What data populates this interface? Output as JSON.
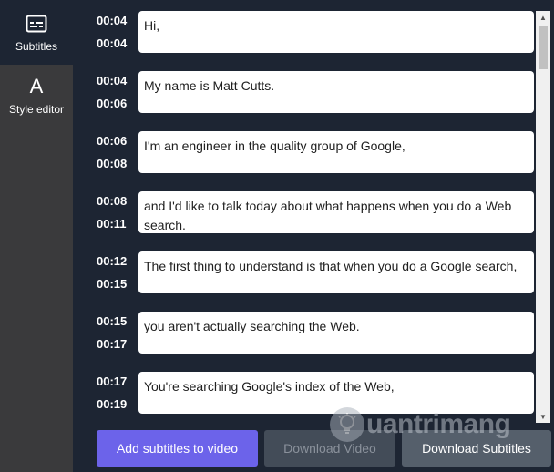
{
  "sidebar": {
    "items": [
      {
        "label": "Subtitles",
        "icon": "subtitles-icon"
      },
      {
        "label": "Style editor",
        "icon": "letter-a-icon",
        "glyph": "A"
      }
    ]
  },
  "subtitles": [
    {
      "start": "00:04",
      "end": "00:04",
      "text": "Hi,"
    },
    {
      "start": "00:04",
      "end": "00:06",
      "text": "My name is Matt Cutts."
    },
    {
      "start": "00:06",
      "end": "00:08",
      "text": "I'm an engineer in the quality group of Google,"
    },
    {
      "start": "00:08",
      "end": "00:11",
      "text": "and I'd like to talk today about what happens when you do a Web search."
    },
    {
      "start": "00:12",
      "end": "00:15",
      "text": "The first thing to understand is that when you do a Google search,"
    },
    {
      "start": "00:15",
      "end": "00:17",
      "text": "you aren't actually searching the Web."
    },
    {
      "start": "00:17",
      "end": "00:19",
      "text": "You're searching Google's index of the Web,"
    }
  ],
  "buttons": {
    "add": "Add subtitles to video",
    "download_video": "Download Video",
    "download_subtitles": "Download Subtitles"
  },
  "watermark": {
    "text": "uantrimang",
    "icon": "bulb-icon"
  },
  "colors": {
    "background": "#1d2533",
    "sidebar": "#3a3a3c",
    "accent": "#6c63ea"
  }
}
